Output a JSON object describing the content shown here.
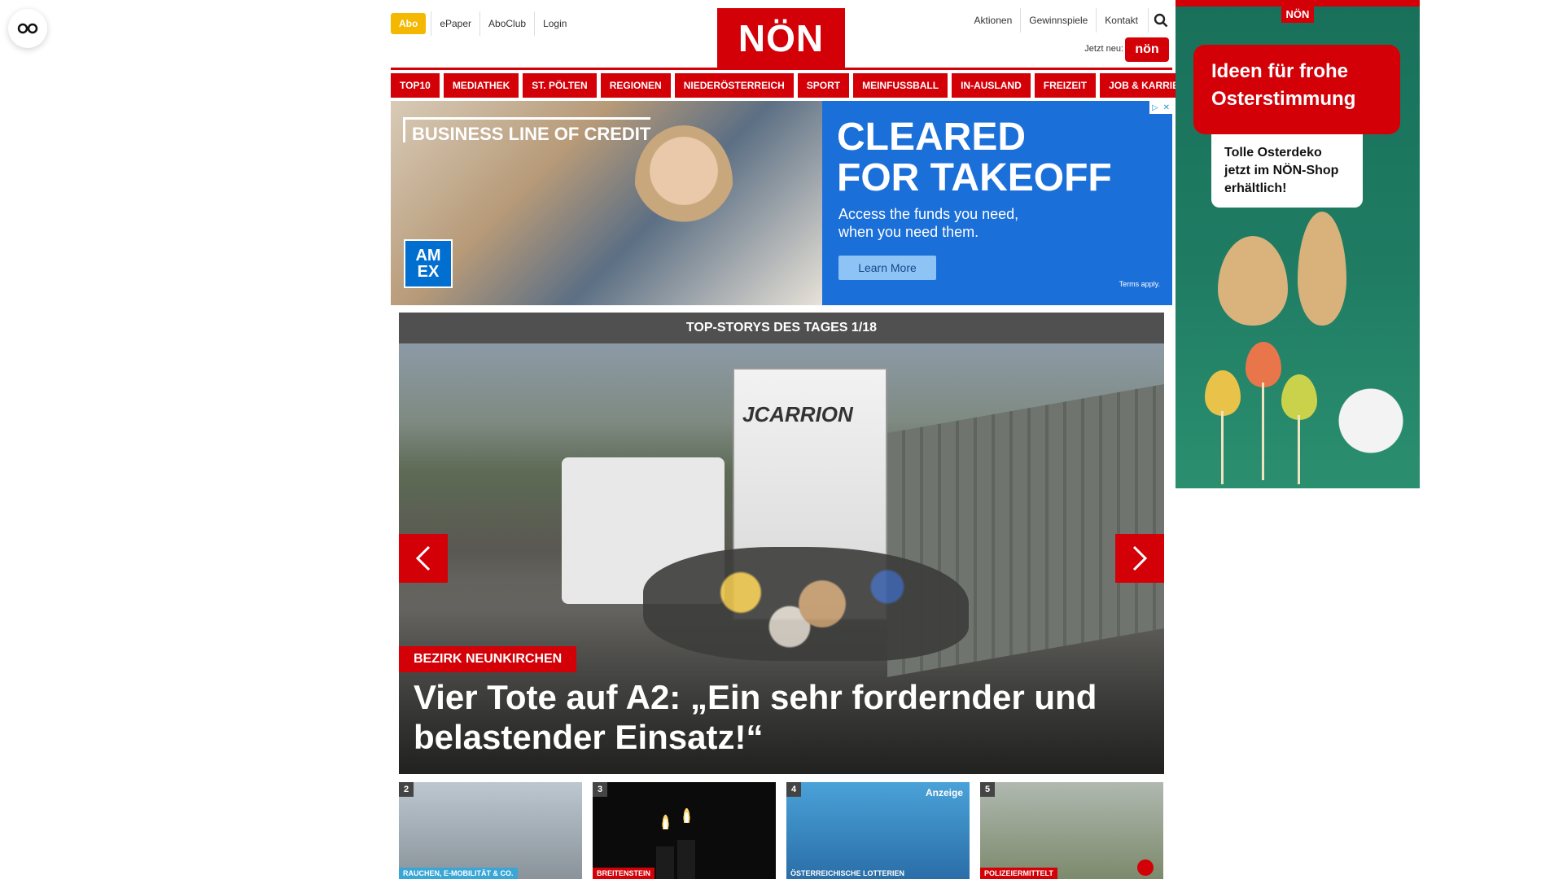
{
  "header": {
    "abo_label": "Abo",
    "left_links": [
      "ePaper",
      "AboClub",
      "Login"
    ],
    "logo_text": "NÖN",
    "right_links": [
      "Aktionen",
      "Gewinnspiele",
      "Kontakt"
    ],
    "jetzt_label": "Jetzt neu:",
    "jetzt_badge_text": "nön"
  },
  "main_nav": [
    "TOP10",
    "MEDIATHEK",
    "ST. PÖLTEN",
    "REGIONEN",
    "NIEDERÖSTERREICH",
    "SPORT",
    "MEINFUSSBALL",
    "IN-AUSLAND",
    "FREIZEIT",
    "JOB & KARRIERE"
  ],
  "banner_ad": {
    "kicker": "BUSINESS LINE OF CREDIT",
    "headline_line1": "CLEARED",
    "headline_line2": "FOR TAKEOFF",
    "sub_line1": "Access the funds you need,",
    "sub_line2": "when you need them.",
    "cta": "Learn More",
    "terms": "Terms apply.",
    "amex_line1": "AM",
    "amex_line2": "EX"
  },
  "sky_ad": {
    "logo": "NÖN",
    "bubble_line1": "Ideen für frohe",
    "bubble_line2": "Osterstimmung",
    "card_line1": "Tolle Osterdeko",
    "card_line2": "jetzt im NÖN-Shop",
    "card_line3": "erhältlich!"
  },
  "top_stories": {
    "bar_title": "TOP-STORYS DES TAGES 1/18",
    "truck_text": "JCARRION",
    "tag": "BEZIRK NEUNKIRCHEN",
    "headline": "Vier Tote auf A2: „Ein sehr fordernder und belastender Einsatz!“"
  },
  "cards": [
    {
      "num": "2",
      "label": "RAUCHEN, E-MOBILITÄT & CO."
    },
    {
      "num": "3",
      "label": "BREITENSTEIN"
    },
    {
      "num": "4",
      "label": "ÖSTERREICHISCHE LOTTERIEN",
      "badge": "Anzeige"
    },
    {
      "num": "5",
      "label": "POLIZEIERMITTELT"
    }
  ],
  "colors": {
    "brand_red": "#d30008",
    "abo_yellow": "#f5b800",
    "amex_blue": "#1b6fd8"
  }
}
